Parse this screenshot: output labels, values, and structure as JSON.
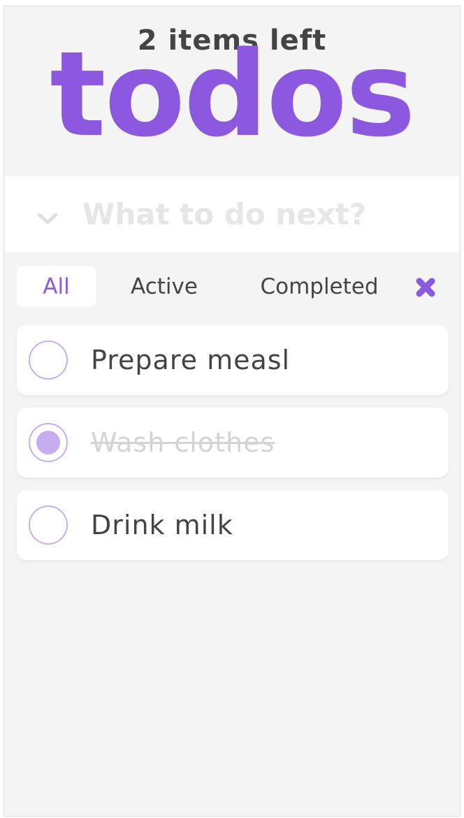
{
  "header": {
    "items_left": "2 items left",
    "title": "todos"
  },
  "new_todo": {
    "placeholder": "What to do next?",
    "value": "",
    "toggle_icon": "chevron-down-icon"
  },
  "filters": {
    "all": "All",
    "active": "Active",
    "completed": "Completed",
    "selected": "All",
    "clear_icon": "close-icon"
  },
  "todos": [
    {
      "label": "Prepare measl",
      "completed": false
    },
    {
      "label": "Wash clothes",
      "completed": true
    },
    {
      "label": "Drink milk",
      "completed": false
    }
  ],
  "colors": {
    "accent": "#8c58e0",
    "text": "#444444",
    "placeholder": "#e6e6e6",
    "background": "#f4f4f5",
    "completed_text": "#d4d4d4",
    "check_fill": "#c8acf0"
  }
}
